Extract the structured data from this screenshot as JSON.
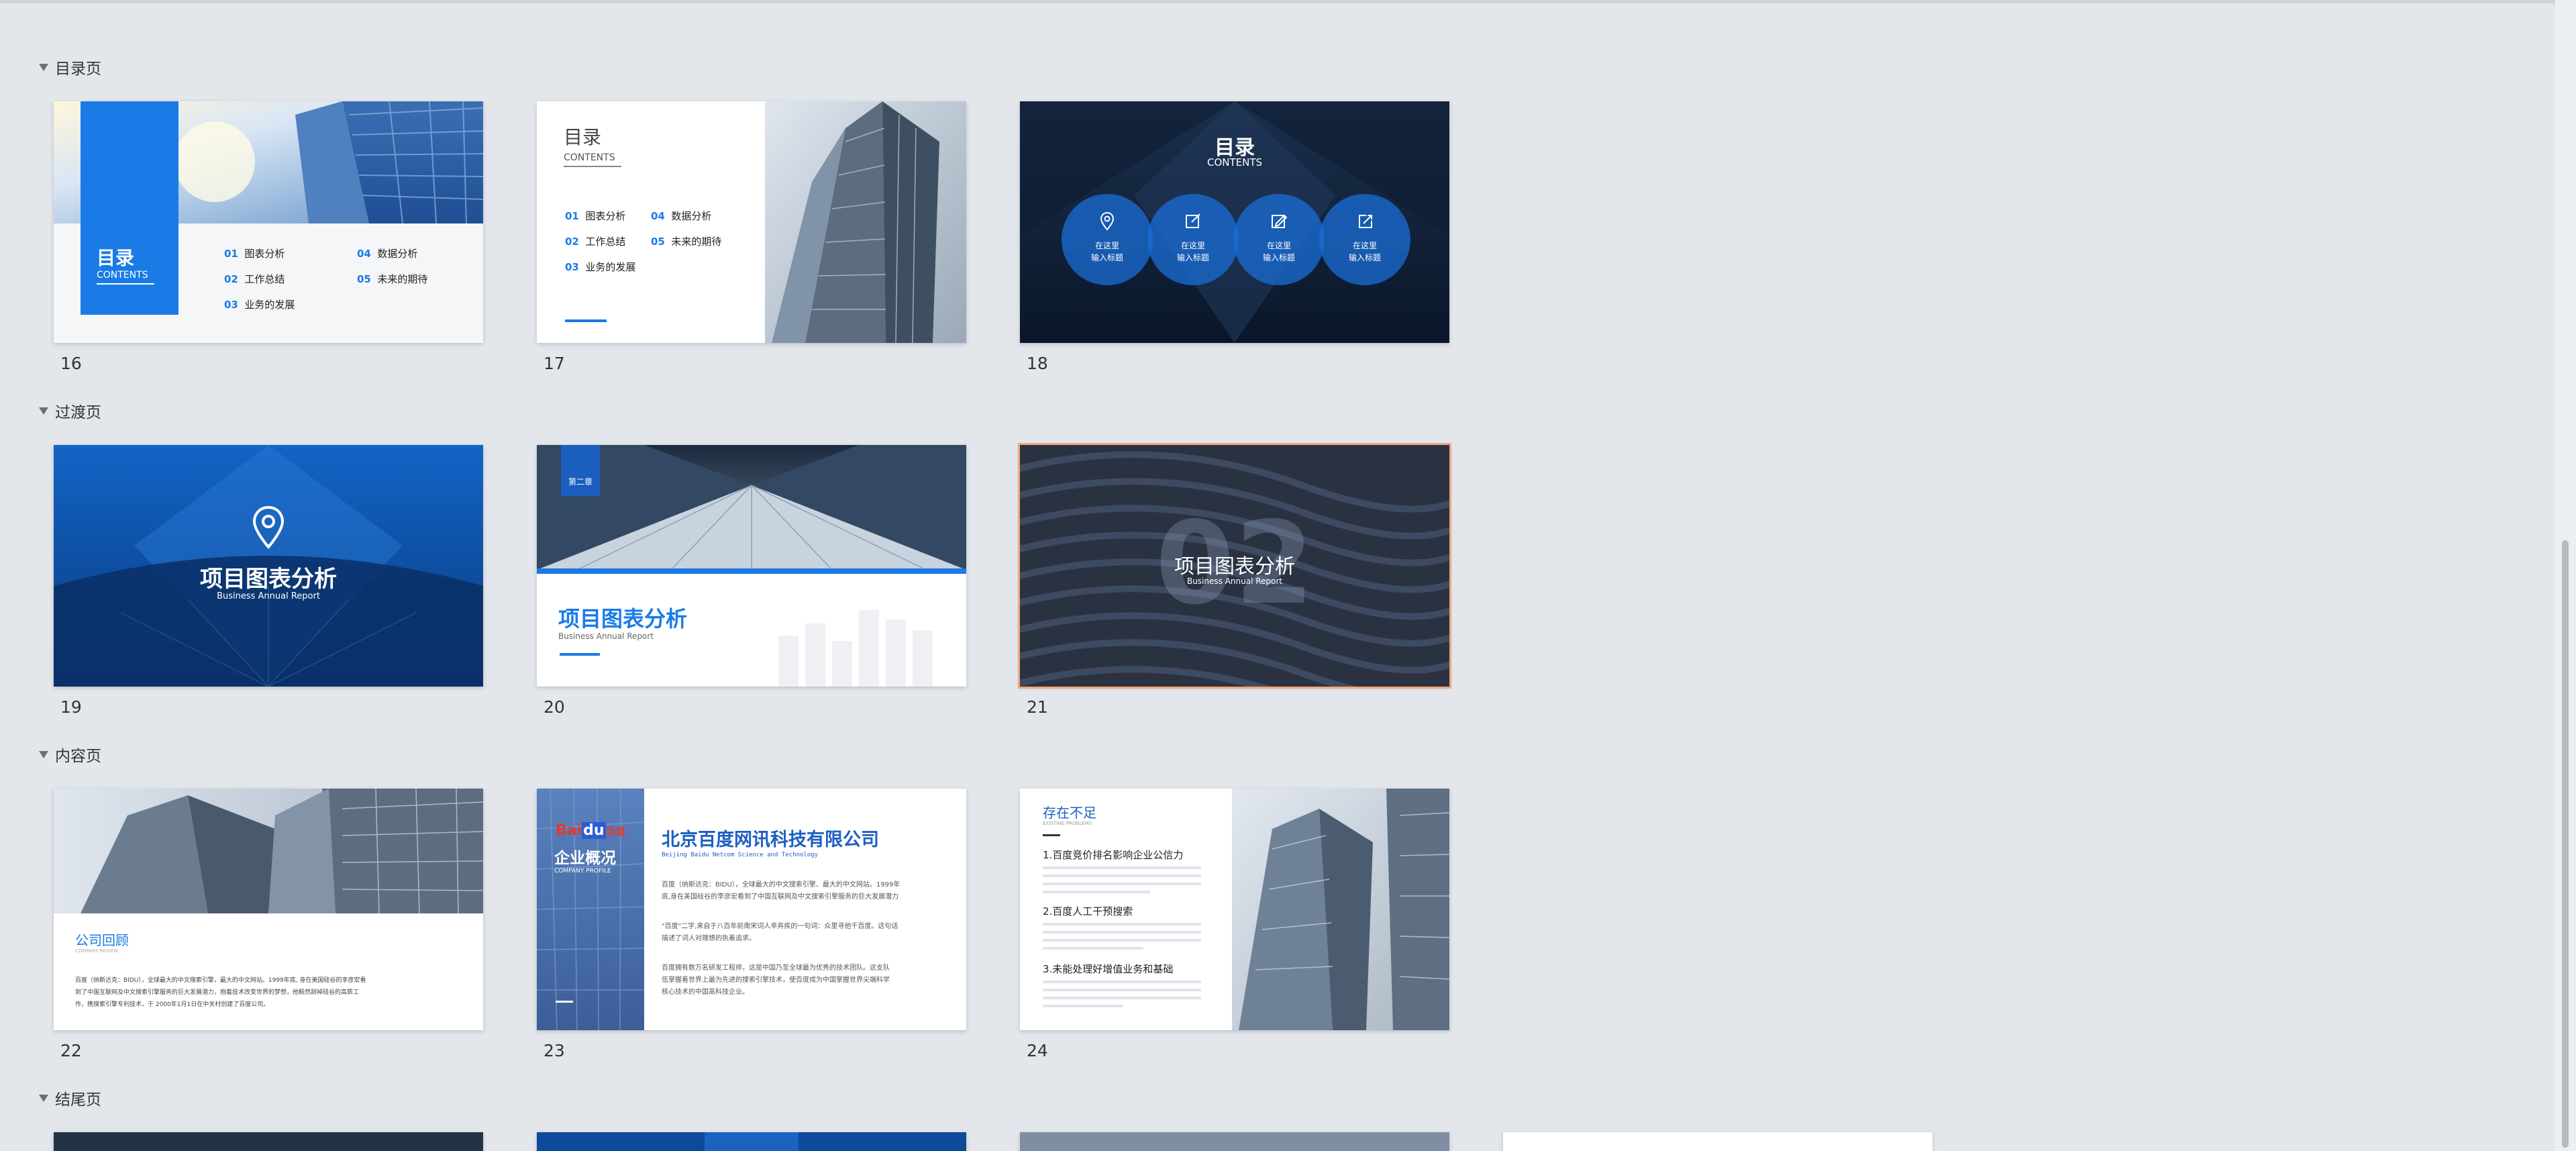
{
  "sections": [
    {
      "title": "目录页"
    },
    {
      "title": "过渡页"
    },
    {
      "title": "内容页"
    },
    {
      "title": "结尾页"
    }
  ],
  "slides": [
    {
      "number": "16"
    },
    {
      "number": "17"
    },
    {
      "number": "18"
    },
    {
      "number": "19"
    },
    {
      "number": "20"
    },
    {
      "number": "21"
    },
    {
      "number": "22"
    },
    {
      "number": "23"
    },
    {
      "number": "24"
    }
  ],
  "s16": {
    "title": "目录",
    "subtitle": "CONTENTS",
    "items": [
      {
        "n": "01",
        "t": "图表分析"
      },
      {
        "n": "02",
        "t": "工作总结"
      },
      {
        "n": "03",
        "t": "业务的发展"
      },
      {
        "n": "04",
        "t": "数据分析"
      },
      {
        "n": "05",
        "t": "未来的期待"
      }
    ]
  },
  "s17": {
    "title": "目录",
    "subtitle": "CONTENTS",
    "items": [
      {
        "n": "01",
        "t": "图表分析"
      },
      {
        "n": "02",
        "t": "工作总结"
      },
      {
        "n": "03",
        "t": "业务的发展"
      },
      {
        "n": "04",
        "t": "数据分析"
      },
      {
        "n": "05",
        "t": "未来的期待"
      }
    ]
  },
  "s18": {
    "title": "目录",
    "subtitle": "CONTENTS",
    "circles": [
      {
        "icon": "location-pin-icon",
        "l1": "在这里",
        "l2": "输入标题"
      },
      {
        "icon": "edit-icon",
        "l1": "在这里",
        "l2": "输入标题"
      },
      {
        "icon": "pencil-icon",
        "l1": "在这里",
        "l2": "输入标题"
      },
      {
        "icon": "share-edit-icon",
        "l1": "在这里",
        "l2": "输入标题"
      }
    ]
  },
  "s19": {
    "title": "项目图表分析",
    "subtitle": "Business Annual Report"
  },
  "s20": {
    "tag": "第二章",
    "title": "项目图表分析",
    "subtitle": "Business Annual Report"
  },
  "s21": {
    "big": "02",
    "title": "项目图表分析",
    "subtitle": "Business Annual Report"
  },
  "s22": {
    "title": "公司回顾",
    "subtitle": "COMPANY REVIEW",
    "body1": "百度（纳斯达克：BIDU），全球最大的中文搜索引擎，最大的中文网站。1999年底, 身在美国硅谷的李彦宏看",
    "body2": "到了中国互联网及中文搜索引擎服务的巨大发展潜力，抱着技术改变世界的梦想，他毅然辞掉硅谷的高薪工",
    "body3": "作，携搜索引擎专利技术，于 2000年1月1日在中关村创建了百度公司。"
  },
  "s23": {
    "logo_a": "Bai",
    "logo_b": "du",
    "logo_c": "百度",
    "side_title": "企业概况",
    "side_sub": "COMPANY PROFILE",
    "title": "北京百度网讯科技有限公司",
    "subtitle": "Beijing Baidu Netcom Science and Technology",
    "p1a": "百度（纳斯达克：BIDU），全球最大的中文搜索引擎、最大的中文网站。1999年",
    "p1b": "底,身在美国硅谷的李彦宏看到了中国互联网及中文搜索引擎服务的巨大发展潜力",
    "p2a": "\"百度\"二字,来自于八百年前南宋词人辛弃疾的一句词：众里寻他千百度。这句话",
    "p2b": "描述了词人对理想的执着追求。",
    "p3a": "百度拥有数万名研发工程师，这是中国乃至全球最为优秀的技术团队。这支队",
    "p3b": "伍掌握着世界上最为先进的搜索引擎技术，使百度成为中国掌握世界尖端科学",
    "p3c": "核心技术的中国高科技企业。"
  },
  "s24": {
    "title": "存在不足",
    "subtitle": "EXISTING PROBLEMS",
    "h1": "1.百度竞价排名影响企业公信力",
    "h2": "2.百度人工干预搜索",
    "h3": "3.未能处理好增值业务和基础"
  }
}
